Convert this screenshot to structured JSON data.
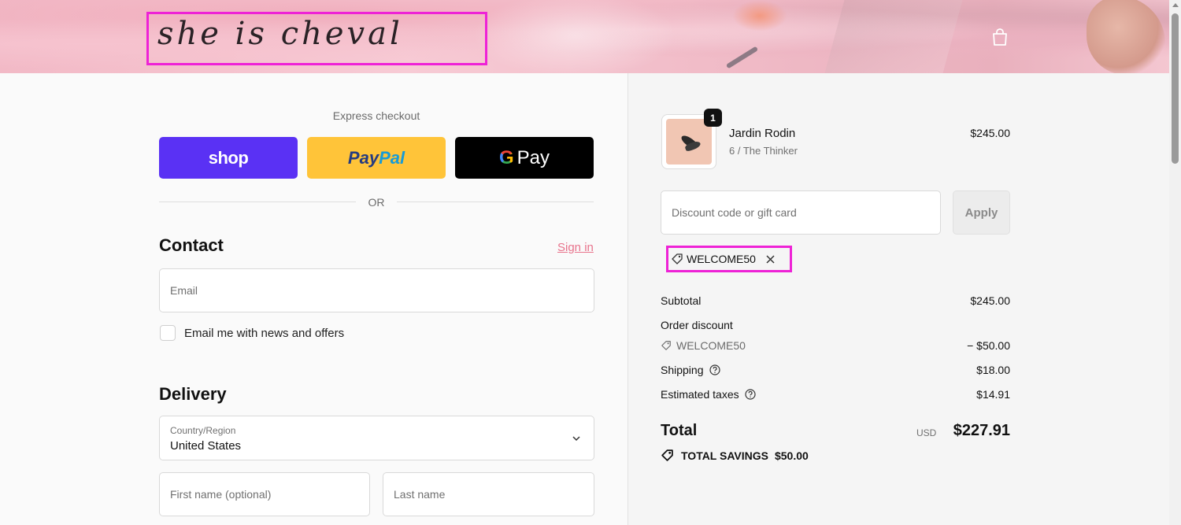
{
  "header": {
    "logo_text": "she is cheval",
    "cart_icon": "shopping-bag-icon"
  },
  "express": {
    "label": "Express checkout",
    "shop_label": "shop",
    "paypal_label_1": "Pay",
    "paypal_label_2": "Pal",
    "gpay_g": "G",
    "gpay_label": "Pay",
    "or_text": "OR"
  },
  "contact": {
    "title": "Contact",
    "sign_in": "Sign in",
    "email_placeholder": "Email",
    "newsletter_label": "Email me with news and offers",
    "newsletter_checked": false
  },
  "delivery": {
    "title": "Delivery",
    "country_label": "Country/Region",
    "country_value": "United States",
    "first_name_placeholder": "First name (optional)",
    "last_name_placeholder": "Last name"
  },
  "order": {
    "product": {
      "name": "Jardin Rodin",
      "variant": "6 / The Thinker",
      "price": "$245.00",
      "quantity": "1"
    },
    "discount_placeholder": "Discount code or gift card",
    "apply_label": "Apply",
    "applied_code": "WELCOME50",
    "subtotal_label": "Subtotal",
    "subtotal_value": "$245.00",
    "order_discount_label": "Order discount",
    "discount_code": "WELCOME50",
    "discount_value": "− $50.00",
    "shipping_label": "Shipping",
    "shipping_value": "$18.00",
    "taxes_label": "Estimated taxes",
    "taxes_value": "$14.91",
    "total_label": "Total",
    "total_currency": "USD",
    "total_value": "$227.91",
    "savings_label": "TOTAL SAVINGS",
    "savings_value": "$50.00"
  },
  "colors": {
    "shop_purple": "#5a31f4",
    "paypal_yellow": "#ffc439",
    "gpay_black": "#000000",
    "link_pink": "#e8738c",
    "highlight_magenta": "#ee22d6"
  }
}
